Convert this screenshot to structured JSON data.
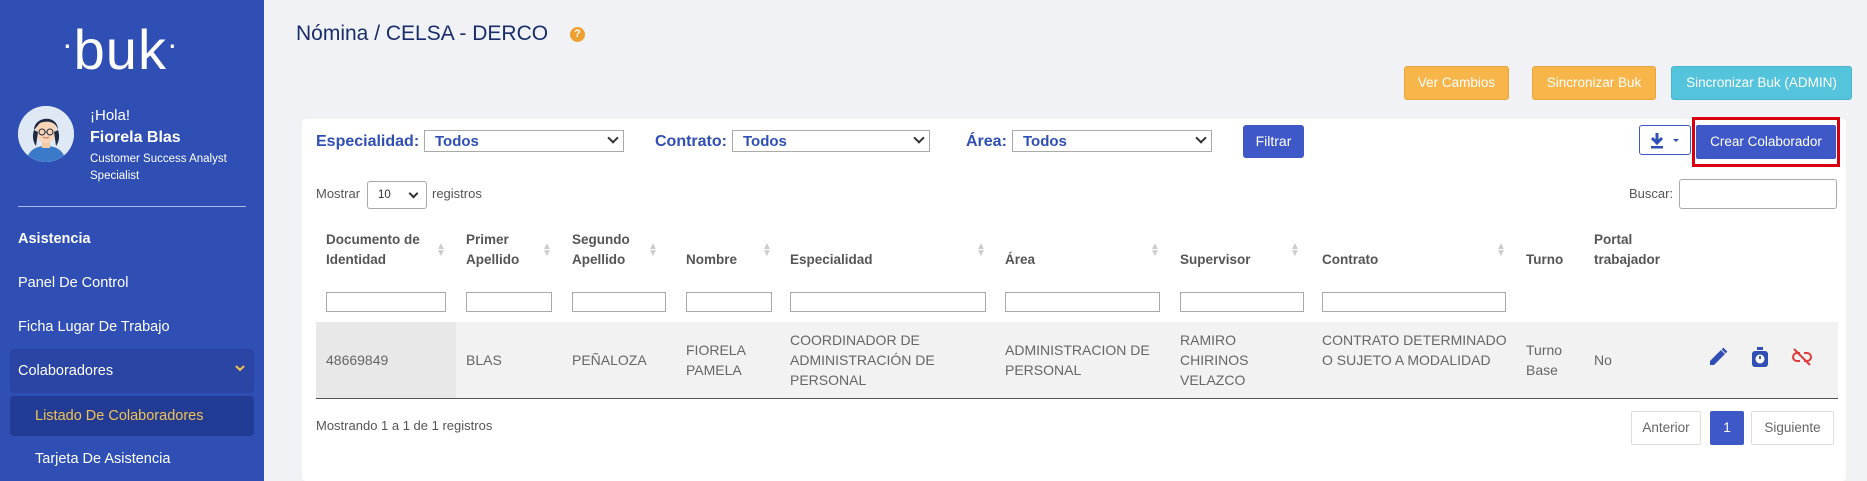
{
  "sidebar": {
    "logo": "buk",
    "greeting": "¡Hola!",
    "user_name": "Fiorela Blas",
    "user_role": "Customer Success Analyst Specialist",
    "section_title": "Asistencia",
    "items": [
      {
        "label": "Panel De Control"
      },
      {
        "label": "Ficha Lugar De Trabajo"
      },
      {
        "label": "Colaboradores"
      },
      {
        "label": "Listado De Colaboradores"
      },
      {
        "label": "Tarjeta De Asistencia"
      }
    ],
    "accent_color": "#f2c14e",
    "background_color": "#2f4fb4"
  },
  "header": {
    "title": "Nómina / CELSA - DERCO",
    "help_icon": "?",
    "buttons": {
      "ver_cambios": "Ver Cambios",
      "sincronizar": "Sincronizar Buk",
      "sincronizar_admin": "Sincronizar Buk (ADMIN)"
    }
  },
  "filters": {
    "especialidad_label": "Especialidad:",
    "especialidad_value": "Todos",
    "contrato_label": "Contrato:",
    "contrato_value": "Todos",
    "area_label": "Área:",
    "area_value": "Todos",
    "filtrar_label": "Filtrar",
    "create_label": "Crear Colaborador"
  },
  "table_controls": {
    "show_label": "Mostrar",
    "page_length": "10",
    "records_label": "registros",
    "search_label": "Buscar:",
    "search_value": ""
  },
  "table": {
    "columns": [
      "Documento de Identidad",
      "Primer Apellido",
      "Segundo Apellido",
      "Nombre",
      "Especialidad",
      "Área",
      "Supervisor",
      "Contrato",
      "Turno",
      "Portal trabajador"
    ],
    "rows": [
      {
        "documento": "48669849",
        "primer_apellido": "BLAS",
        "segundo_apellido": "PEÑALOZA",
        "nombre": "FIORELA PAMELA",
        "especialidad": "COORDINADOR DE ADMINISTRACIÓN DE PERSONAL",
        "area": "ADMINISTRACION DE PERSONAL",
        "supervisor": "RAMIRO CHIRINOS VELAZCO",
        "contrato": "CONTRATO DETERMINADO O SUJETO A MODALIDAD",
        "turno": "Turno Base",
        "portal": "No"
      }
    ]
  },
  "footer": {
    "info": "Mostrando 1 a 1 de 1 registros",
    "prev": "Anterior",
    "page": "1",
    "next": "Siguiente"
  }
}
